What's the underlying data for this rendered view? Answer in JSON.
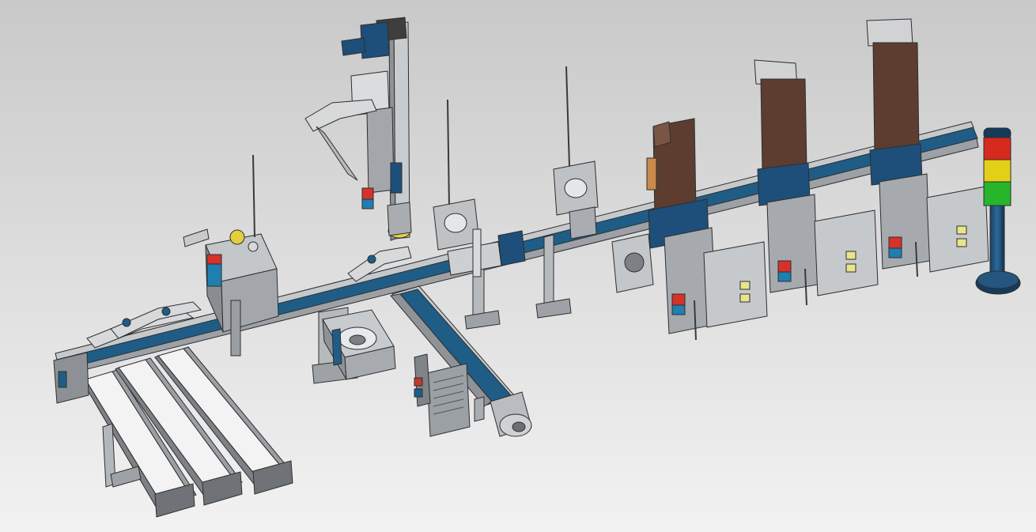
{
  "viewport": {
    "background_top": "#c9c9c9",
    "background_bottom": "#f2f2f2"
  },
  "colors": {
    "belt_blue": "#1f5d86",
    "frame_grey": "#8b8f93",
    "frame_light": "#c3c6c9",
    "outline": "#2e2e2e",
    "cylinder_blue": "#1d4f7a",
    "brown_part": "#5c3d30",
    "lamp_red": "#d62a1f",
    "lamp_yellow": "#e4cf18",
    "lamp_green": "#27b52c",
    "lamp_base": "#163a5a"
  },
  "signal_tower": {
    "segments": [
      "red",
      "yellow",
      "green"
    ]
  }
}
